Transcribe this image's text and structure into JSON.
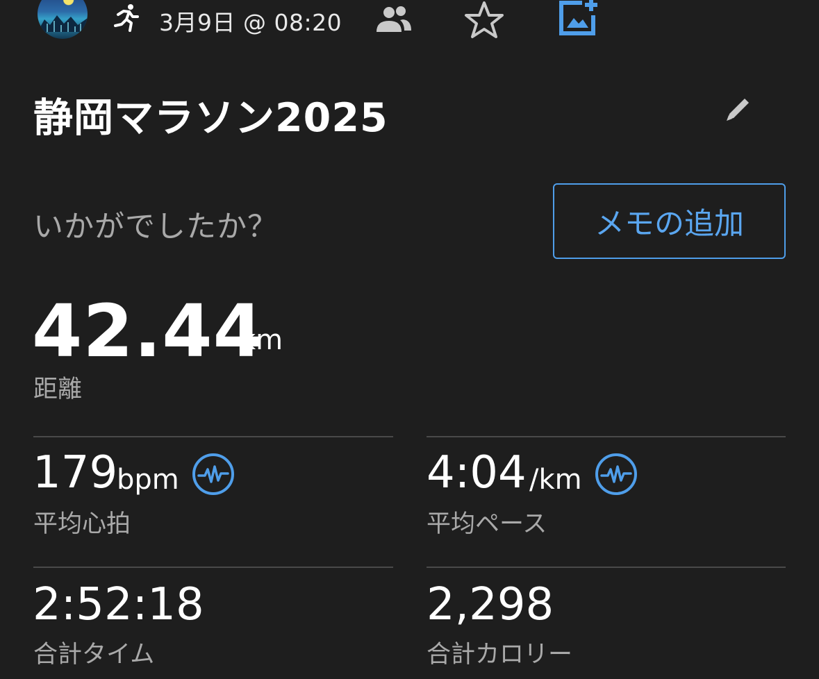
{
  "header": {
    "activity_icon": "running-icon",
    "date_time": "3月9日 @ 08:20",
    "icons": [
      "people-icon",
      "star-icon",
      "add-photo-icon"
    ]
  },
  "activity": {
    "title": "静岡マラソン2025",
    "edit_icon": "pencil-icon"
  },
  "note": {
    "prompt": "いかがでしたか？",
    "add_memo_label": "メモの追加"
  },
  "distance": {
    "value": "42.44",
    "unit": "km",
    "label": "距離"
  },
  "stats": {
    "avg_hr": {
      "value": "179",
      "unit": "bpm",
      "label": "平均心拍",
      "icon": "heart-rate-icon"
    },
    "avg_pace": {
      "value": "4:04",
      "unit": "/km",
      "label": "平均ペース",
      "icon": "heart-rate-icon"
    },
    "total_time": {
      "value": "2:52:18",
      "label": "合計タイム"
    },
    "total_calories": {
      "value": "2,298",
      "label": "合計カロリー"
    }
  },
  "colors": {
    "background": "#1e1e1e",
    "accent": "#4f9eea",
    "secondary_text": "#a9a9a9",
    "divider": "#4a4a4a"
  }
}
